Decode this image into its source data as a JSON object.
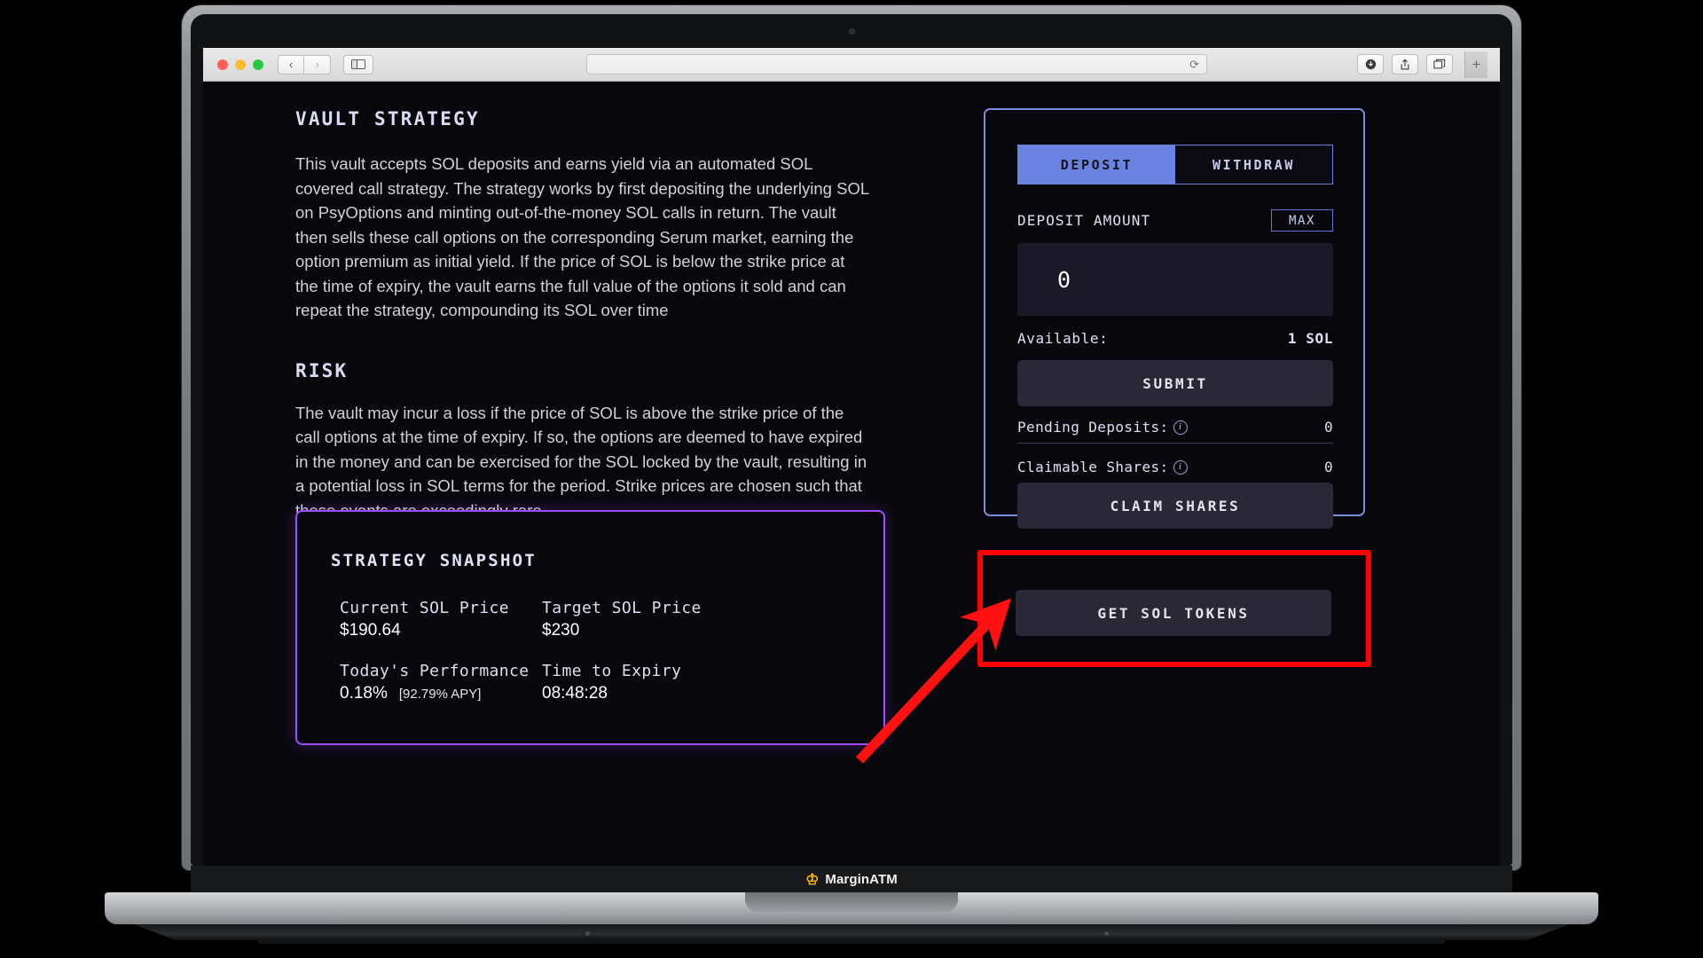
{
  "browser": {
    "traffic_lights": [
      "close",
      "minimize",
      "maximize"
    ],
    "back_icon": "‹",
    "forward_icon": "›",
    "sidebar_icon": "sidebar-icon",
    "url_value": "",
    "url_placeholder": "",
    "reload_icon": "⟳",
    "download_icon": "⬇",
    "share_icon": "⬆",
    "tabs_icon": "⧉",
    "new_tab_icon": "+"
  },
  "laptop": {
    "brand_mark": "♔",
    "brand_text": "MarginATM"
  },
  "content": {
    "vault_strategy": {
      "title": "VAULT STRATEGY",
      "body": "This vault accepts SOL deposits and earns yield via an automated SOL covered call strategy. The strategy works by first depositing the underlying SOL on PsyOptions and minting out-of-the-money SOL calls in return. The vault then sells these call options on the corresponding Serum market, earning the option premium as initial yield. If the price of SOL is below the strike price at the time of expiry, the vault earns the full value of the options it sold and can repeat the strategy, compounding its SOL over time"
    },
    "risk": {
      "title": "RISK",
      "body": "The vault may incur a loss if the price of SOL is above the strike price of the call options at the time of expiry. If so, the options are deemed to have expired in the money and can be exercised for the SOL locked by the vault, resulting in a potential loss in SOL terms for the period. Strike prices are chosen such that these events are exceedingly rare."
    },
    "snapshot": {
      "title": "STRATEGY SNAPSHOT",
      "current_sol_price_label": "Current SOL Price",
      "current_sol_price_value": "$190.64",
      "target_sol_price_label": "Target SOL Price",
      "target_sol_price_value": "$230",
      "todays_performance_label": "Today's Performance",
      "todays_performance_value": "0.18%",
      "todays_performance_apy": "[92.79% APY]",
      "time_to_expiry_label": "Time to Expiry",
      "time_to_expiry_value": "08:48:28"
    }
  },
  "vault_panel": {
    "tab_deposit": "DEPOSIT",
    "tab_withdraw": "WITHDRAW",
    "active_tab": "DEPOSIT",
    "amount_label": "DEPOSIT AMOUNT",
    "max_label": "MAX",
    "amount_value": "0",
    "amount_placeholder": "0",
    "available_label": "Available:",
    "available_value": "1 SOL",
    "submit_label": "SUBMIT",
    "pending_deposits_label": "Pending Deposits:",
    "pending_deposits_info": "i",
    "pending_deposits_value": "0",
    "claimable_shares_label": "Claimable Shares:",
    "claimable_shares_info": "i",
    "claimable_shares_value": "0",
    "claim_shares_label": "CLAIM SHARES"
  },
  "cta": {
    "get_sol_tokens_label": "GET SOL TOKENS"
  },
  "annotation": {
    "highlight_color": "#ff0000",
    "arrow_color": "#ff1111"
  },
  "colors": {
    "panel_border": "#7b8bdd",
    "tab_active_bg": "#6b83e0",
    "snapshot_border": "#9b4dff",
    "page_bg": "#08080c",
    "button_bg": "#2a2736",
    "input_bg": "#1b1828"
  }
}
